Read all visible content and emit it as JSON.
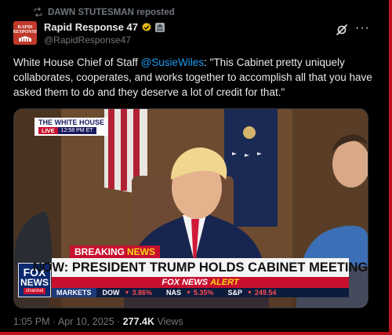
{
  "repost": {
    "text": "DAWN STUTESMAN reposted",
    "icon": "repost-icon"
  },
  "author": {
    "name": "Rapid Response 47",
    "handle": "@RapidResponse47",
    "avatar_text": "RAPID RESPONSE",
    "verified_color": "#e2b719",
    "affiliation_icon": "government-building-icon"
  },
  "actions": {
    "grok_icon": "grok-icon",
    "more_label": "···"
  },
  "tweet": {
    "prefix": "White House Chief of Staff ",
    "mention": "@SusieWiles",
    "body": ": \"This Cabinet pretty uniquely collaborates, cooperates, and works together to accomplish all that you have asked them to do and they deserve a lot of credit for that.\""
  },
  "video": {
    "wh_title": "THE WHITE HOUSE",
    "wh_live": "LIVE",
    "wh_time": "12:58 PM ET",
    "fox_line1": "FOX",
    "fox_line2": "NEWS",
    "fox_line3": "channel",
    "breaking_a": "BREAKING",
    "breaking_b": "NEWS",
    "headline": "NOW: PRESIDENT TRUMP HOLDS CABINET MEETING",
    "alert_a": "FOX NEWS",
    "alert_b": "ALERT",
    "ticker": {
      "markets": "MARKETS",
      "dow_label": "DOW",
      "dow_value": "3.86%",
      "nas_label": "NAS",
      "nas_value": "5.35%",
      "sp_label": "S&P",
      "sp_value": "249.54"
    }
  },
  "meta": {
    "time": "1:05 PM · Apr 10, 2025 · ",
    "views": "277.4K",
    "views_label": " Views"
  },
  "colors": {
    "accent": "#1d9bf0",
    "fox_red": "#c8102e",
    "frame": "#c1121f"
  }
}
